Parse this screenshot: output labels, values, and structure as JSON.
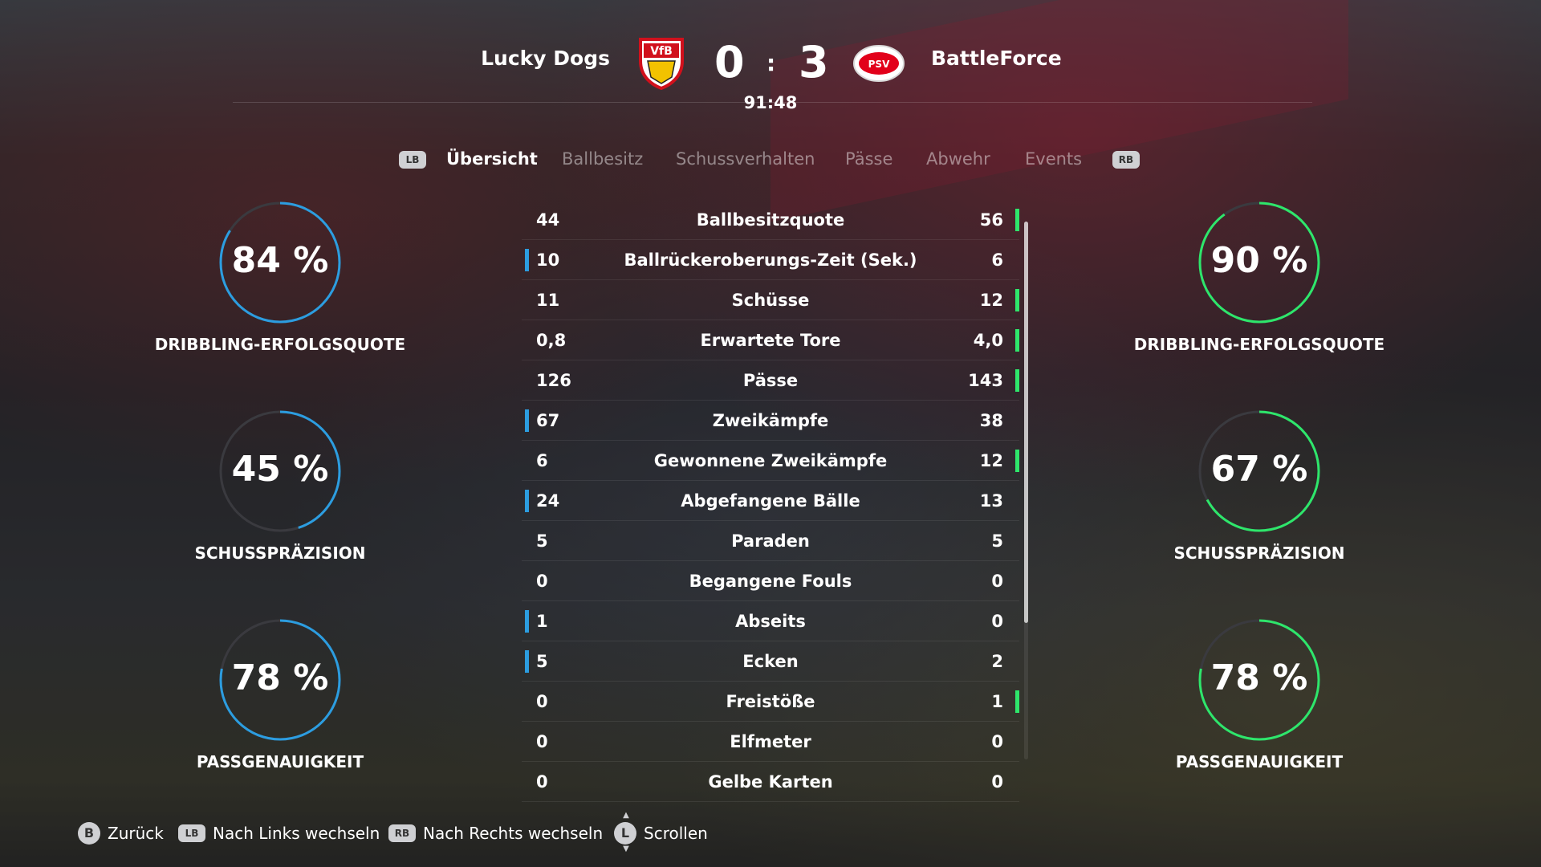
{
  "match": {
    "home_team": "Lucky Dogs",
    "away_team": "BattleForce",
    "home_score": "0",
    "separator": ":",
    "away_score": "3",
    "clock": "91:48",
    "home_crest_text": "VfB",
    "away_crest_text": "PSV"
  },
  "tabs": {
    "lb": "LB",
    "rb": "RB",
    "items": [
      "Übersicht",
      "Ballbesitz",
      "Schussverhalten",
      "Pässe",
      "Abwehr",
      "Events"
    ],
    "active": "Übersicht"
  },
  "stats": [
    {
      "home": "44",
      "label": "Ballbesitzquote",
      "away": "56",
      "leader": "away"
    },
    {
      "home": "10",
      "label": "Ballrückeroberungs-Zeit (Sek.)",
      "away": "6",
      "leader": "home"
    },
    {
      "home": "11",
      "label": "Schüsse",
      "away": "12",
      "leader": "away"
    },
    {
      "home": "0,8",
      "label": "Erwartete Tore",
      "away": "4,0",
      "leader": "away"
    },
    {
      "home": "126",
      "label": "Pässe",
      "away": "143",
      "leader": "away"
    },
    {
      "home": "67",
      "label": "Zweikämpfe",
      "away": "38",
      "leader": "home"
    },
    {
      "home": "6",
      "label": "Gewonnene Zweikämpfe",
      "away": "12",
      "leader": "away"
    },
    {
      "home": "24",
      "label": "Abgefangene Bälle",
      "away": "13",
      "leader": "home"
    },
    {
      "home": "5",
      "label": "Paraden",
      "away": "5",
      "leader": "none"
    },
    {
      "home": "0",
      "label": "Begangene Fouls",
      "away": "0",
      "leader": "none"
    },
    {
      "home": "1",
      "label": "Abseits",
      "away": "0",
      "leader": "home"
    },
    {
      "home": "5",
      "label": "Ecken",
      "away": "2",
      "leader": "home"
    },
    {
      "home": "0",
      "label": "Freistöße",
      "away": "1",
      "leader": "away"
    },
    {
      "home": "0",
      "label": "Elfmeter",
      "away": "0",
      "leader": "none"
    },
    {
      "home": "0",
      "label": "Gelbe Karten",
      "away": "0",
      "leader": "none"
    }
  ],
  "home_rings": [
    {
      "value": "84 %",
      "fraction": 0.84,
      "label": "DRIBBLING-ERFOLGSQUOTE"
    },
    {
      "value": "45 %",
      "fraction": 0.45,
      "label": "SCHUSSPRÄZISION"
    },
    {
      "value": "78 %",
      "fraction": 0.78,
      "label": "PASSGENAUIGKEIT"
    }
  ],
  "away_rings": [
    {
      "value": "90 %",
      "fraction": 0.9,
      "label": "DRIBBLING-ERFOLGSQUOTE"
    },
    {
      "value": "67 %",
      "fraction": 0.67,
      "label": "SCHUSSPRÄZISION"
    },
    {
      "value": "78 %",
      "fraction": 0.78,
      "label": "PASSGENAUIGKEIT"
    }
  ],
  "colors": {
    "home_accent": "#2c9de0",
    "away_accent": "#2ee66b",
    "ring_track": "#3a3a3f"
  },
  "footer": {
    "back_btn": "B",
    "back": "Zurück",
    "left_btn": "LB",
    "left": "Nach Links wechseln",
    "right_btn": "RB",
    "right": "Nach Rechts wechseln",
    "scroll_btn": "L",
    "scroll": "Scrollen"
  }
}
